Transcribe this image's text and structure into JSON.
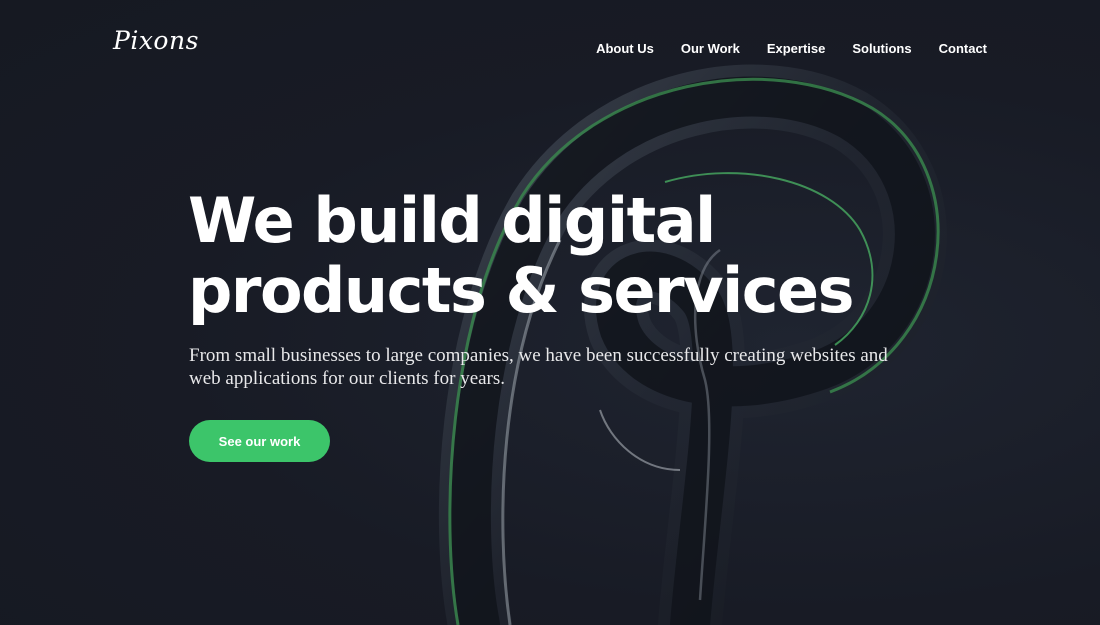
{
  "brand": {
    "logo_text": "Pixons"
  },
  "nav": {
    "items": [
      {
        "label": "About Us"
      },
      {
        "label": "Our Work"
      },
      {
        "label": "Expertise"
      },
      {
        "label": "Solutions"
      },
      {
        "label": "Contact"
      }
    ]
  },
  "hero": {
    "headline_line1": "We build digital",
    "headline_line2": "products & services",
    "subtext": "From small businesses to large companies, we have been successfully creating websites and web applications for our clients for years.",
    "cta_label": "See our work",
    "art_icon": "glass-letter-p-icon"
  },
  "colors": {
    "background": "#181b25",
    "accent": "#3cc56a",
    "text": "#ffffff"
  }
}
